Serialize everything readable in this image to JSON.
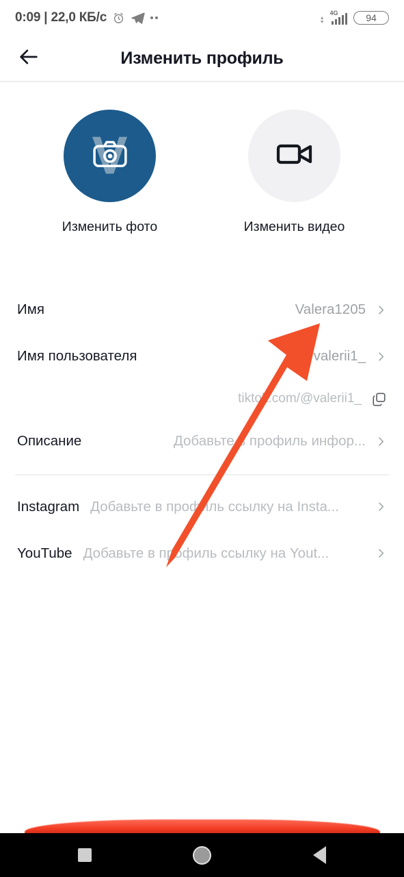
{
  "statusbar": {
    "time_traffic": "0:09 | 22,0 КБ/с",
    "alarm_icon": "alarm-clock-icon",
    "telegram_icon": "telegram-icon",
    "more_icon": "more-notifications-icon",
    "network_type": "4G",
    "signal_icon": "signal-bars-icon",
    "battery_level": "94"
  },
  "header": {
    "back_icon": "back-arrow-icon",
    "title": "Изменить профиль"
  },
  "media": {
    "photo": {
      "label": "Изменить фото",
      "icon": "camera-icon",
      "avatar_letter": "V",
      "avatar_color": "#1c5b8c"
    },
    "video": {
      "label": "Изменить видео",
      "icon": "video-camera-icon",
      "circle_color": "#f1f1f3"
    }
  },
  "form": {
    "rows": [
      {
        "label": "Имя",
        "value": "Valera1205",
        "chevron": "chevron-right-icon"
      },
      {
        "label": "Имя пользователя",
        "value": "valerii1_",
        "chevron": "chevron-right-icon"
      }
    ],
    "url": {
      "text": "tiktok.com/@valerii1_",
      "copy_icon": "copy-icon"
    },
    "bio": {
      "label": "Описание",
      "placeholder": "Добавьте в профиль инфор...",
      "chevron": "chevron-right-icon"
    },
    "social": [
      {
        "label": "Instagram",
        "placeholder": "Добавьте в профиль ссылку на Insta...",
        "chevron": "chevron-right-icon"
      },
      {
        "label": "YouTube",
        "placeholder": "Добавьте в профиль ссылку на Yout...",
        "chevron": "chevron-right-icon"
      }
    ]
  },
  "annotation": {
    "arrow_icon": "red-pointer-arrow",
    "arrow_color": "#f2502a"
  },
  "navbar": {
    "recents_icon": "recents-square-icon",
    "home_icon": "home-circle-icon",
    "back_icon": "back-triangle-icon"
  }
}
